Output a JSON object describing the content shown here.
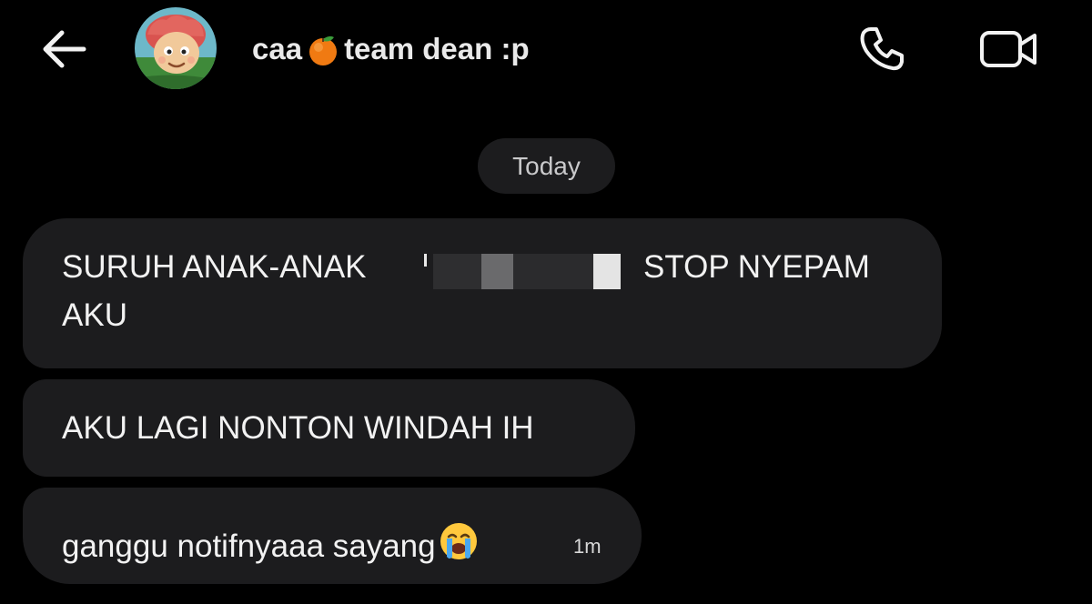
{
  "header": {
    "name_part1": "caa",
    "name_emoji": "tangerine-emoji",
    "name_part2": "team dean :p",
    "icons": {
      "back": "arrow-left-icon",
      "call": "phone-icon",
      "video": "video-camera-icon"
    }
  },
  "chat": {
    "date_label": "Today",
    "messages": [
      {
        "text_before": "SURUH ANAK-ANAK",
        "text_after": "STOP NYEPAM",
        "text_line2": "AKU",
        "redacted": true
      },
      {
        "text": "AKU LAGI NONTON WINDAH IH"
      },
      {
        "text": "ganggu notifnyaaa sayang",
        "emoji": "loudly-crying-face-emoji",
        "time": "1m"
      }
    ]
  },
  "colors": {
    "background": "#000000",
    "bubble": "#1c1c1e",
    "text": "#f2f2f2",
    "muted": "#c9c9cb"
  }
}
